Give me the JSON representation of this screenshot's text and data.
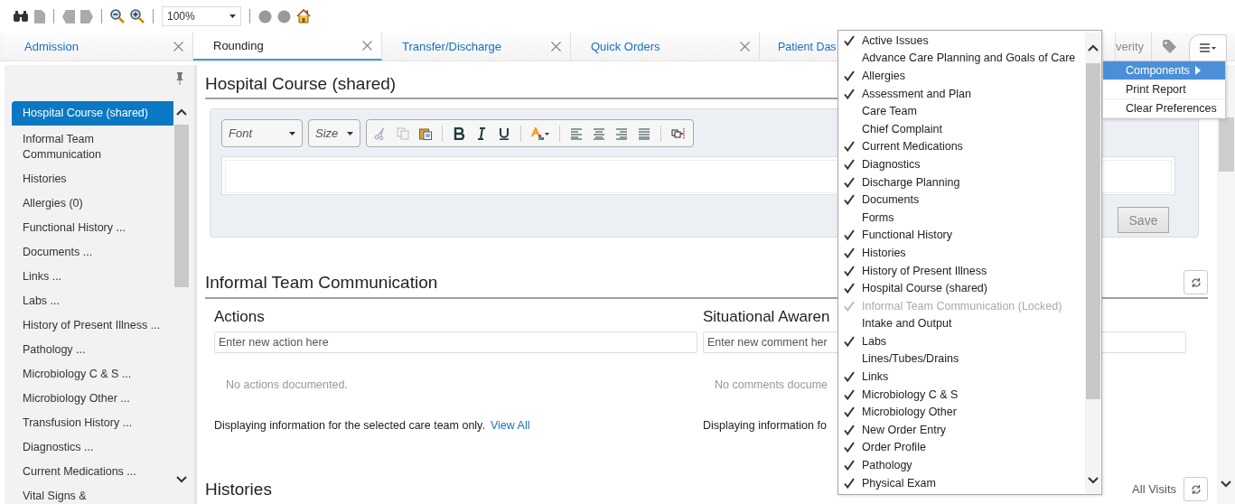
{
  "toolbar": {
    "zoom": "100%"
  },
  "tabs": [
    {
      "label": "Admission",
      "selected": false,
      "closable": true
    },
    {
      "label": "Rounding",
      "selected": true,
      "closable": true
    },
    {
      "label": "Transfer/Discharge",
      "selected": false,
      "closable": true
    },
    {
      "label": "Quick Orders",
      "selected": false,
      "closable": true
    },
    {
      "label": "Patient Das",
      "selected": false,
      "closable": false
    },
    {
      "label": "verity",
      "selected": false,
      "closable": false
    }
  ],
  "sidebar": {
    "items": [
      {
        "label": "Hospital Course (shared)",
        "selected": true
      },
      {
        "label": "Informal Team\nCommunication",
        "selected": false
      },
      {
        "label": "Histories",
        "selected": false
      },
      {
        "label": "Allergies (0)",
        "selected": false
      },
      {
        "label": "Functional History ...",
        "selected": false
      },
      {
        "label": "Documents ...",
        "selected": false
      },
      {
        "label": "Links ...",
        "selected": false
      },
      {
        "label": "Labs ...",
        "selected": false
      },
      {
        "label": "History of Present Illness ...",
        "selected": false
      },
      {
        "label": "Pathology ...",
        "selected": false
      },
      {
        "label": "Microbiology C & S ...",
        "selected": false
      },
      {
        "label": "Microbiology Other ...",
        "selected": false
      },
      {
        "label": "Transfusion History ...",
        "selected": false
      },
      {
        "label": "Diagnostics ...",
        "selected": false
      },
      {
        "label": "Current Medications ...",
        "selected": false
      },
      {
        "label": "Vital Signs &",
        "selected": false
      }
    ]
  },
  "hospital_course": {
    "title": "Hospital Course (shared)",
    "font": "Font",
    "size": "Size",
    "save": {
      "label": "Save",
      "disabled": true
    }
  },
  "informal_team": {
    "title": "Informal Team Communication",
    "columns": [
      {
        "title": "Actions",
        "placeholder": "Enter new action here",
        "empty": "No actions documented.",
        "footer": "Displaying information for the selected care team only.",
        "link": "View All"
      },
      {
        "title": "Situational Awaren",
        "placeholder": "Enter new comment her",
        "empty": "No comments docume",
        "footer": "Displaying information fo"
      }
    ]
  },
  "histories": {
    "title": "Histories",
    "filter": "All Visits"
  },
  "components_menu": {
    "items": [
      {
        "label": "Active Issues",
        "checked": true,
        "disabled": false
      },
      {
        "label": "Advance Care Planning and Goals of Care",
        "checked": false,
        "disabled": false
      },
      {
        "label": "Allergies",
        "checked": true,
        "disabled": false
      },
      {
        "label": "Assessment and Plan",
        "checked": true,
        "disabled": false
      },
      {
        "label": "Care Team",
        "checked": false,
        "disabled": false
      },
      {
        "label": "Chief Complaint",
        "checked": false,
        "disabled": false
      },
      {
        "label": "Current Medications",
        "checked": true,
        "disabled": false
      },
      {
        "label": "Diagnostics",
        "checked": true,
        "disabled": false
      },
      {
        "label": "Discharge Planning",
        "checked": true,
        "disabled": false
      },
      {
        "label": "Documents",
        "checked": true,
        "disabled": false
      },
      {
        "label": "Forms",
        "checked": false,
        "disabled": false
      },
      {
        "label": "Functional History",
        "checked": true,
        "disabled": false
      },
      {
        "label": "Histories",
        "checked": true,
        "disabled": false
      },
      {
        "label": "History of Present Illness",
        "checked": true,
        "disabled": false
      },
      {
        "label": "Hospital Course (shared)",
        "checked": true,
        "disabled": false
      },
      {
        "label": "Informal Team Communication (Locked)",
        "checked": true,
        "disabled": true
      },
      {
        "label": "Intake and Output",
        "checked": false,
        "disabled": false
      },
      {
        "label": "Labs",
        "checked": true,
        "disabled": false
      },
      {
        "label": "Lines/Tubes/Drains",
        "checked": false,
        "disabled": false
      },
      {
        "label": "Links",
        "checked": true,
        "disabled": false
      },
      {
        "label": "Microbiology C & S",
        "checked": true,
        "disabled": false
      },
      {
        "label": "Microbiology Other",
        "checked": true,
        "disabled": false
      },
      {
        "label": "New Order Entry",
        "checked": true,
        "disabled": false
      },
      {
        "label": "Order Profile",
        "checked": true,
        "disabled": false
      },
      {
        "label": "Pathology",
        "checked": true,
        "disabled": false
      },
      {
        "label": "Physical Exam",
        "checked": true,
        "disabled": false
      }
    ]
  },
  "context_menu": {
    "items": [
      {
        "label": "Components",
        "selected": true,
        "submenu": true
      },
      {
        "label": "Print Report",
        "selected": false,
        "submenu": false
      },
      {
        "label": "Clear Preferences",
        "selected": false,
        "submenu": false
      }
    ]
  }
}
